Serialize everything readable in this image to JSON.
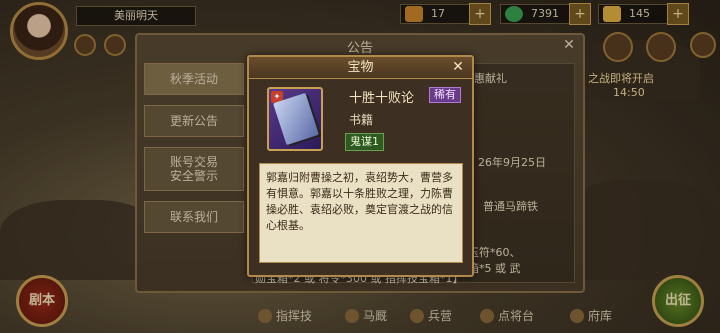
{
  "hud": {
    "player_name": "美丽明天",
    "resources": [
      {
        "value": "17",
        "icon": "ticket-icon",
        "color": "#c8862a"
      },
      {
        "value": "7391",
        "icon": "jade-icon",
        "color": "#3aa050"
      },
      {
        "value": "145",
        "icon": "gold-icon",
        "color": "#e0b040"
      }
    ]
  },
  "notice": {
    "title": "公告",
    "close": "✕",
    "menu": [
      "秋季活动",
      "更新公告",
      "账号交易\n安全警示",
      "联系我们"
    ],
    "body_texts": [
      "特惠献礼",
      "之战即将开启",
      "14:50",
      "26年9月25日",
      "普通马蹄铁",
      "玉符*60、",
      "箱*5 或 武",
      "勋宝箱*2 或 将令*300 或 指挥技宝箱*1】"
    ]
  },
  "bottom": {
    "items": [
      "指挥技",
      "马厩",
      "兵营",
      "点将台",
      "府库"
    ],
    "left_button": "剧本",
    "right_button": "出征"
  },
  "popup": {
    "title": "宝物",
    "close": "✕",
    "item_name": "十胜十败论",
    "rarity": "稀有",
    "item_type": "书籍",
    "tag": "鬼谋1",
    "description": "郭嘉归附曹操之初，袁绍势大，曹营多有惧意。郭嘉以十条胜败之理，力陈曹操必胜、袁绍必败，奠定官渡之战的信心根基。"
  }
}
